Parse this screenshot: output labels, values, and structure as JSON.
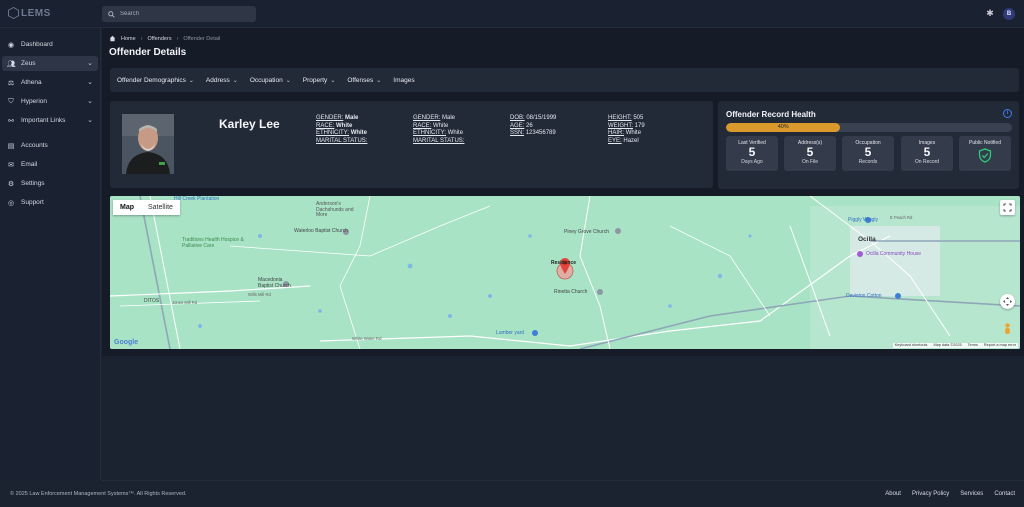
{
  "app": {
    "logo_text": "LEMS",
    "search_placeholder": "Search",
    "avatar_initial": "B"
  },
  "sidebar": {
    "items": [
      {
        "label": "Dashboard",
        "icon": "dashboard-icon"
      },
      {
        "label": "Zeus",
        "icon": "users-icon",
        "expandable": true,
        "active": true
      },
      {
        "label": "Athena",
        "icon": "scale-icon",
        "expandable": true
      },
      {
        "label": "Hyperion",
        "icon": "shield-icon",
        "expandable": true
      },
      {
        "label": "Important Links",
        "icon": "link-icon",
        "expandable": true
      },
      {
        "label": "Accounts",
        "icon": "accounts-icon"
      },
      {
        "label": "Email",
        "icon": "mail-icon"
      },
      {
        "label": "Settings",
        "icon": "gear-icon"
      },
      {
        "label": "Support",
        "icon": "support-icon"
      }
    ]
  },
  "breadcrumb": {
    "home": "Home",
    "section": "Offenders",
    "current": "Offender Detail"
  },
  "page": {
    "title": "Offender Details"
  },
  "tabs": [
    {
      "label": "Offender Demographics",
      "dropdown": true
    },
    {
      "label": "Address",
      "dropdown": true
    },
    {
      "label": "Occupation",
      "dropdown": true
    },
    {
      "label": "Property",
      "dropdown": true
    },
    {
      "label": "Offenses",
      "dropdown": true
    },
    {
      "label": "Images",
      "dropdown": false
    }
  ],
  "profile": {
    "name": "Karley Lee",
    "summary": {
      "gender_label": "GENDER:",
      "gender": "Male",
      "race_label": "RACE:",
      "race": "White",
      "ethnicity_label": "ETHNICITY:",
      "ethnicity": "White",
      "marital_label": "MARITAL STATUS:",
      "marital": ""
    },
    "col1": {
      "gender_label": "GENDER:",
      "gender": "Male",
      "race_label": "RACE:",
      "race": "White",
      "ethnicity_label": "ETHNICITY:",
      "ethnicity": "White",
      "marital_label": "MARITAL STATUS:",
      "marital": ""
    },
    "col2": {
      "dob_label": "DOB:",
      "dob": "08/15/1999",
      "age_label": "AGE:",
      "age": "26",
      "ssn_label": "SSN:",
      "ssn": "123456789"
    },
    "col3": {
      "height_label": "HEIGHT:",
      "height": "505",
      "weight_label": "WEIGHT:",
      "weight": "179",
      "hair_label": "HAIR:",
      "hair": "White",
      "eye_label": "EYE:",
      "eye": "Hazel"
    }
  },
  "health": {
    "title": "Offender Record Health",
    "progress_value": 0.4,
    "progress_label": "40%",
    "stats": [
      {
        "label": "Last Verified",
        "value": "5",
        "sub": "Days Ago"
      },
      {
        "label": "Address(s)",
        "value": "5",
        "sub": "On File"
      },
      {
        "label": "Occupation",
        "value": "5",
        "sub": "Records"
      },
      {
        "label": "Images",
        "value": "5",
        "sub": "On Record"
      },
      {
        "label": "Public Notified",
        "value": "",
        "sub": "",
        "icon": "shield-check-icon"
      }
    ]
  },
  "map": {
    "view_map": "Map",
    "view_satellite": "Satellite",
    "marker_label": "Residence",
    "places": {
      "plantation": "Hill Creek Plantation",
      "andersons": "Anderson's Dachshunds and More",
      "waterloo": "Waterloo Baptist Church",
      "piney": "Piney Grove Church",
      "traditions": "Traditions Health Hospice & Palliative Care",
      "macedonia": "Macedonia Baptist Church",
      "ditos": "DITOS",
      "rd1": "Jones Mill Rd",
      "rd2": "Wills Mill Rd",
      "rinetta": "Rinetta Church",
      "lumber": "Lumber yard",
      "whitewater": "White Water Rd",
      "piggly": "Piggly Wiggly",
      "ocilla": "Ocilla",
      "community": "Ocilla Community House",
      "daviston": "Daviston Cotton",
      "hwy": "E Peach Rd"
    },
    "google": "Google",
    "attrib_shortcuts": "Keyboard shortcuts",
    "attrib_data": "Map data ©2025",
    "attrib_terms": "Terms",
    "attrib_report": "Report a map error"
  },
  "footer": {
    "copyright": "© 2025 Law Enforcement Management Systems™. All Rights Reserved.",
    "links": [
      "About",
      "Privacy Policy",
      "Services",
      "Contact"
    ]
  },
  "colors": {
    "accent": "#d99a2b",
    "info": "#3d7bf0",
    "public_notified": "#2fc87a"
  }
}
